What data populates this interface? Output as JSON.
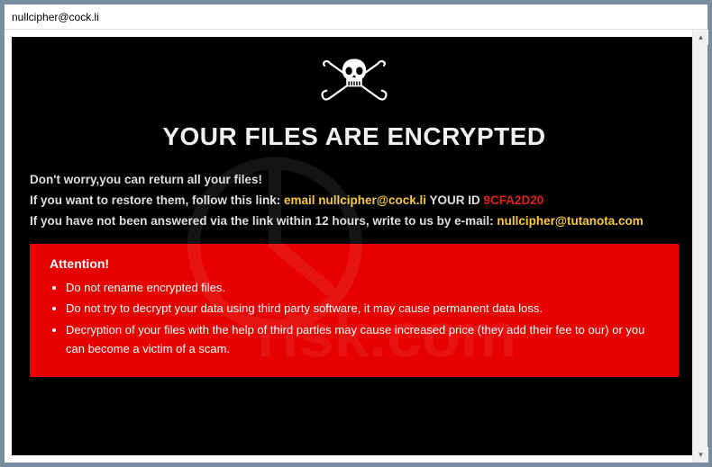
{
  "window": {
    "title": "nullcipher@cock.li"
  },
  "ransom": {
    "heading": "YOUR FILES ARE ENCRYPTED",
    "line1": "Don't worry,you can return all your files!",
    "line2_prefix": "If you want to restore them, follow this link: ",
    "line2_link": "email nullcipher@cock.li",
    "line2_id_label": " YOUR ID ",
    "line2_id_value": "9CFA2D20",
    "line3_prefix": "If you have not been answered via the link within 12 hours, write to us by e-mail: ",
    "line3_email": "nullcipher@tutanota.com",
    "attention": {
      "title": "Attention!",
      "items": [
        "Do not rename encrypted files.",
        "Do not try to decrypt your data using third party software, it may cause permanent data loss.",
        "Decryption of your files with the help of third parties may cause increased price (they add their fee to our) or you can become a victim of a scam."
      ]
    }
  },
  "icons": {
    "skull": "skull-swords-icon",
    "scroll_up": "▴",
    "scroll_down": "▾"
  }
}
